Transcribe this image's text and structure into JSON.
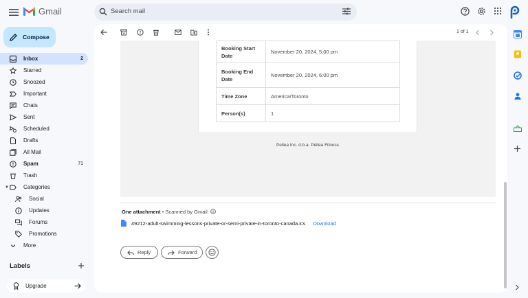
{
  "app": {
    "name": "Gmail"
  },
  "search": {
    "placeholder": "Search mail"
  },
  "compose_label": "Compose",
  "nav": [
    {
      "label": "Inbox",
      "count": "2",
      "icon": "inbox-icon",
      "active": true
    },
    {
      "label": "Starred",
      "count": "",
      "icon": "star-icon"
    },
    {
      "label": "Snoozed",
      "count": "",
      "icon": "clock-icon"
    },
    {
      "label": "Important",
      "count": "",
      "icon": "important-icon"
    },
    {
      "label": "Chats",
      "count": "",
      "icon": "chat-icon"
    },
    {
      "label": "Sent",
      "count": "",
      "icon": "send-icon"
    },
    {
      "label": "Scheduled",
      "count": "",
      "icon": "scheduled-icon"
    },
    {
      "label": "Drafts",
      "count": "",
      "icon": "draft-icon"
    },
    {
      "label": "All Mail",
      "count": "",
      "icon": "all-mail-icon"
    },
    {
      "label": "Spam",
      "count": "71",
      "icon": "spam-icon"
    },
    {
      "label": "Trash",
      "count": "",
      "icon": "trash-icon"
    },
    {
      "label": "Categories",
      "count": "",
      "icon": "label-icon"
    },
    {
      "label": "Social",
      "count": "",
      "icon": "social-icon"
    },
    {
      "label": "Updates",
      "count": "",
      "icon": "updates-icon"
    },
    {
      "label": "Forums",
      "count": "",
      "icon": "forums-icon"
    },
    {
      "label": "Promotions",
      "count": "",
      "icon": "promotions-icon"
    },
    {
      "label": "More",
      "count": "",
      "icon": "chevron-down-icon"
    }
  ],
  "labels_header": "Labels",
  "upgrade_label": "Upgrade",
  "pager": "1 of 1",
  "booking_table": [
    {
      "key": "Booking Start Date",
      "value": "November 20, 2024, 5:00 pm"
    },
    {
      "key": "Booking End Date",
      "value": "November 20, 2024, 6:00 pm"
    },
    {
      "key": "Time Zone",
      "value": "America/Toronto"
    },
    {
      "key": "Person(s)",
      "value": "1"
    }
  ],
  "footer_note": "Pellea Inc. d.b.a. Pellea Fitness",
  "attachment": {
    "title": "One attachment",
    "scanned": " • Scanned by Gmail",
    "filename": "49212-adult-swimming-lessons-private-or-semi-private-in-toronto-canada.ics",
    "download": "Download"
  },
  "actions": {
    "reply": "Reply",
    "forward": "Forward"
  },
  "colors": {
    "accent": "#1a73e8",
    "compose": "#c2e7ff",
    "active_nav": "#d3e3fd",
    "background": "#f6f8fc"
  }
}
